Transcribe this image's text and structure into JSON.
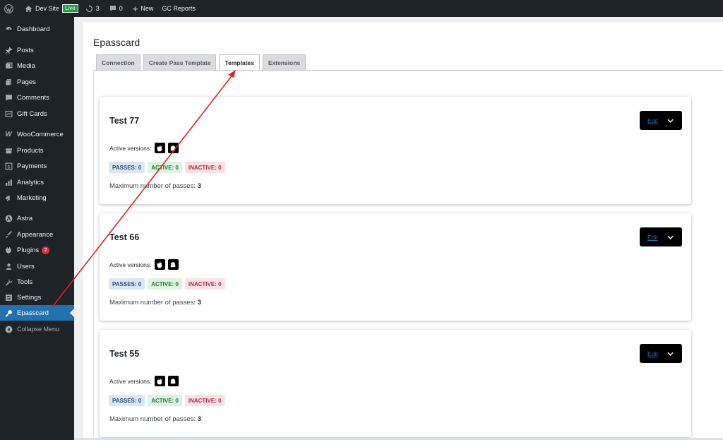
{
  "adminbar": {
    "site_name": "Dev Site",
    "live_label": "Live",
    "updates_count": "3",
    "comments_count": "0",
    "new_label": "New",
    "gc_reports_label": "GC Reports"
  },
  "sidebar": {
    "items": [
      {
        "label": "Dashboard",
        "icon": "dashboard-icon"
      },
      {
        "label": "Posts",
        "icon": "pin-icon"
      },
      {
        "label": "Media",
        "icon": "media-icon"
      },
      {
        "label": "Pages",
        "icon": "pages-icon"
      },
      {
        "label": "Comments",
        "icon": "comment-icon"
      },
      {
        "label": "Gift Cards",
        "icon": "gift-card-icon"
      },
      {
        "label": "WooCommerce",
        "icon": "woocommerce-icon"
      },
      {
        "label": "Products",
        "icon": "products-icon"
      },
      {
        "label": "Payments",
        "icon": "payments-icon"
      },
      {
        "label": "Analytics",
        "icon": "analytics-icon"
      },
      {
        "label": "Marketing",
        "icon": "megaphone-icon"
      },
      {
        "label": "Astra",
        "icon": "astra-icon"
      },
      {
        "label": "Appearance",
        "icon": "brush-icon"
      },
      {
        "label": "Plugins",
        "icon": "plugin-icon",
        "badge": "2"
      },
      {
        "label": "Users",
        "icon": "users-icon"
      },
      {
        "label": "Tools",
        "icon": "wrench-icon"
      },
      {
        "label": "Settings",
        "icon": "settings-icon"
      },
      {
        "label": "Epasscard",
        "icon": "key-icon",
        "active": true
      },
      {
        "label": "Collapse Menu",
        "icon": "collapse-icon"
      }
    ]
  },
  "page": {
    "title": "Epasscard",
    "tabs": [
      {
        "label": "Connection"
      },
      {
        "label": "Create Pass Template"
      },
      {
        "label": "Templates",
        "active": true
      },
      {
        "label": "Extensions"
      }
    ]
  },
  "templates": [
    {
      "title": "Test 77",
      "active_versions_label": "Active versions:",
      "passes": "PASSES: 0",
      "active": "ACTIVE: 0",
      "inactive": "INACTIVE: 0",
      "max_label": "Maximum number of passes:",
      "max_value": "3",
      "edit_label": "Edit"
    },
    {
      "title": "Test 66",
      "active_versions_label": "Active versions:",
      "passes": "PASSES: 0",
      "active": "ACTIVE: 0",
      "inactive": "INACTIVE: 0",
      "max_label": "Maximum number of passes:",
      "max_value": "3",
      "edit_label": "Edit"
    },
    {
      "title": "Test 55",
      "active_versions_label": "Active versions:",
      "passes": "PASSES: 0",
      "active": "ACTIVE: 0",
      "inactive": "INACTIVE: 0",
      "max_label": "Maximum number of passes:",
      "max_value": "3",
      "edit_label": "Edit"
    }
  ],
  "colors": {
    "admin_bg": "#1d2327",
    "active_menu": "#2271b1",
    "annotation_arrow": "#e02020"
  }
}
